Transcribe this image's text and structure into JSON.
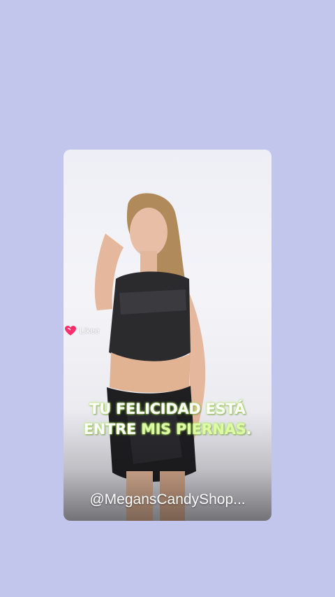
{
  "watermark": {
    "label": "Likee",
    "icon": "heart-icon"
  },
  "caption": {
    "line1": "TU FELICIDAD ESTÁ",
    "line2_a": "ENTRE ",
    "line2_b": "MIS PIERNAS",
    "line2_c": "."
  },
  "handle": "@MegansCandyShop...",
  "colors": {
    "background": "#c3c6ec",
    "heart": "#ff2f6e",
    "caption_glow": "#b9f36a"
  }
}
